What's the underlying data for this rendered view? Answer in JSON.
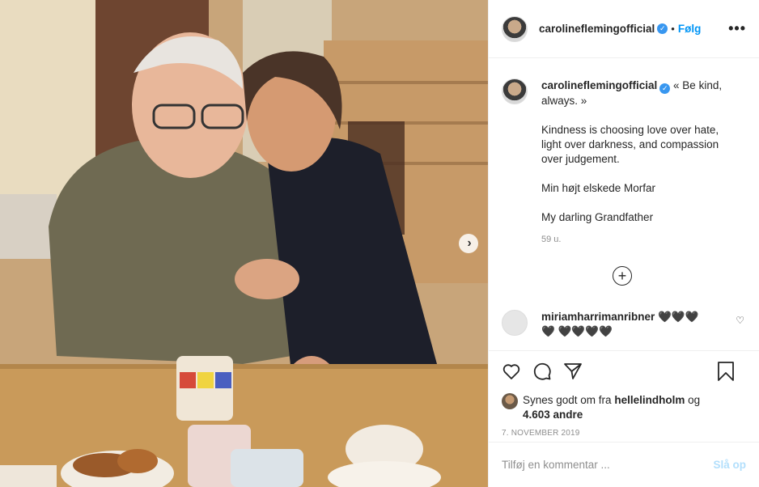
{
  "post": {
    "username": "carolineflemingofficial",
    "follow_label": "Følg",
    "more_icon": "more-horizontal-icon",
    "caption_lines": [
      "« Be kind,",
      "always. »"
    ],
    "caption_paragraphs": [
      "Kindness is choosing love over hate, light over darkness, and compassion over judgement.",
      "Min højt elskede Morfar",
      "My darling Grandfather"
    ],
    "time_ago": "59 u.",
    "load_more_icon": "plus-circle-icon"
  },
  "comment": {
    "username": "miriamharrimanribner",
    "text": "🖤🖤🖤🖤 🖤🖤🖤🖤"
  },
  "likes": {
    "prefix": "Synes godt om fra",
    "user": "hellelindholm",
    "connector": "og",
    "count": "4.603 andre"
  },
  "date": "7. NOVEMBER 2019",
  "add_comment": {
    "placeholder": "Tilføj en kommentar ...",
    "post_label": "Slå op"
  },
  "colors": {
    "accent": "#0095f6",
    "verified": "#3897f0",
    "post_disabled": "#b2dffc"
  }
}
